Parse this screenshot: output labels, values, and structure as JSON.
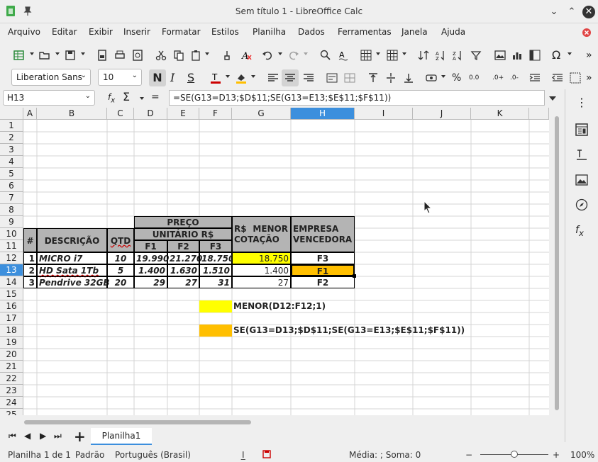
{
  "window": {
    "title": "Sem título 1 - LibreOffice Calc"
  },
  "menu": [
    "Arquivo",
    "Editar",
    "Exibir",
    "Inserir",
    "Formatar",
    "Estilos",
    "Planilha",
    "Dados",
    "Ferramentas",
    "Janela",
    "Ajuda"
  ],
  "format": {
    "font": "Liberation Sans",
    "size": "10"
  },
  "formula": {
    "cellref": "H13",
    "content": "=SE(G13=D13;$D$11;SE(G13=E13;$E$11;$F$11))"
  },
  "columns": [
    "A",
    "B",
    "C",
    "D",
    "E",
    "F",
    "G",
    "H",
    "I",
    "J",
    "K"
  ],
  "rows": [
    "1",
    "2",
    "3",
    "4",
    "5",
    "6",
    "7",
    "8",
    "9",
    "10",
    "11",
    "12",
    "13",
    "14",
    "15",
    "16",
    "17",
    "18",
    "19",
    "20",
    "21",
    "22",
    "23",
    "24",
    "25"
  ],
  "table": {
    "header_preco": "PREÇO",
    "header_unitario": "UNITÁRIO R$",
    "header_menor": "R$    MENOR COTAÇÃO",
    "header_menor_a": "R$",
    "header_menor_b": "MENOR",
    "header_menor_c": "COTAÇÃO",
    "header_empresa_a": "EMPRESA",
    "header_empresa_b": "VENCEDORA",
    "header_num": "#",
    "header_desc": "DESCRIÇÃO",
    "header_qtd": "QTD",
    "header_f1": "F1",
    "header_f2": "F2",
    "header_f3": "F3",
    "items": [
      {
        "n": "1",
        "desc": "MICRO i7",
        "qtd": "10",
        "f1": "19.990",
        "f2": "21.270",
        "f3": "18.750",
        "menor": "18.750",
        "venc": "F3"
      },
      {
        "n": "2",
        "desc": "HD Sata 1Tb",
        "qtd": "5",
        "f1": "1.400",
        "f2": "1.630",
        "f3": "1.510",
        "menor": "1.400",
        "venc": "F1"
      },
      {
        "n": "3",
        "desc": "Pendrive 32GB",
        "qtd": "20",
        "f1": "29",
        "f2": "27",
        "f3": "31",
        "menor": "27",
        "venc": "F2"
      }
    ]
  },
  "legend": {
    "yellow_label": "MENOR(D12:F12;1)",
    "orange_label": "SE(G13=D13;$D$11;SE(G13=E13;$E$11;$F$11))",
    "yellow": "#ffff00",
    "orange": "#ffbf00"
  },
  "tabs": {
    "sheet1": "Planilha1"
  },
  "status": {
    "sheet": "Planilha 1 de 1",
    "style": "Padrão",
    "lang": "Português (Brasil)",
    "sum": "Média: ; Soma: 0",
    "zoom": "100%"
  }
}
